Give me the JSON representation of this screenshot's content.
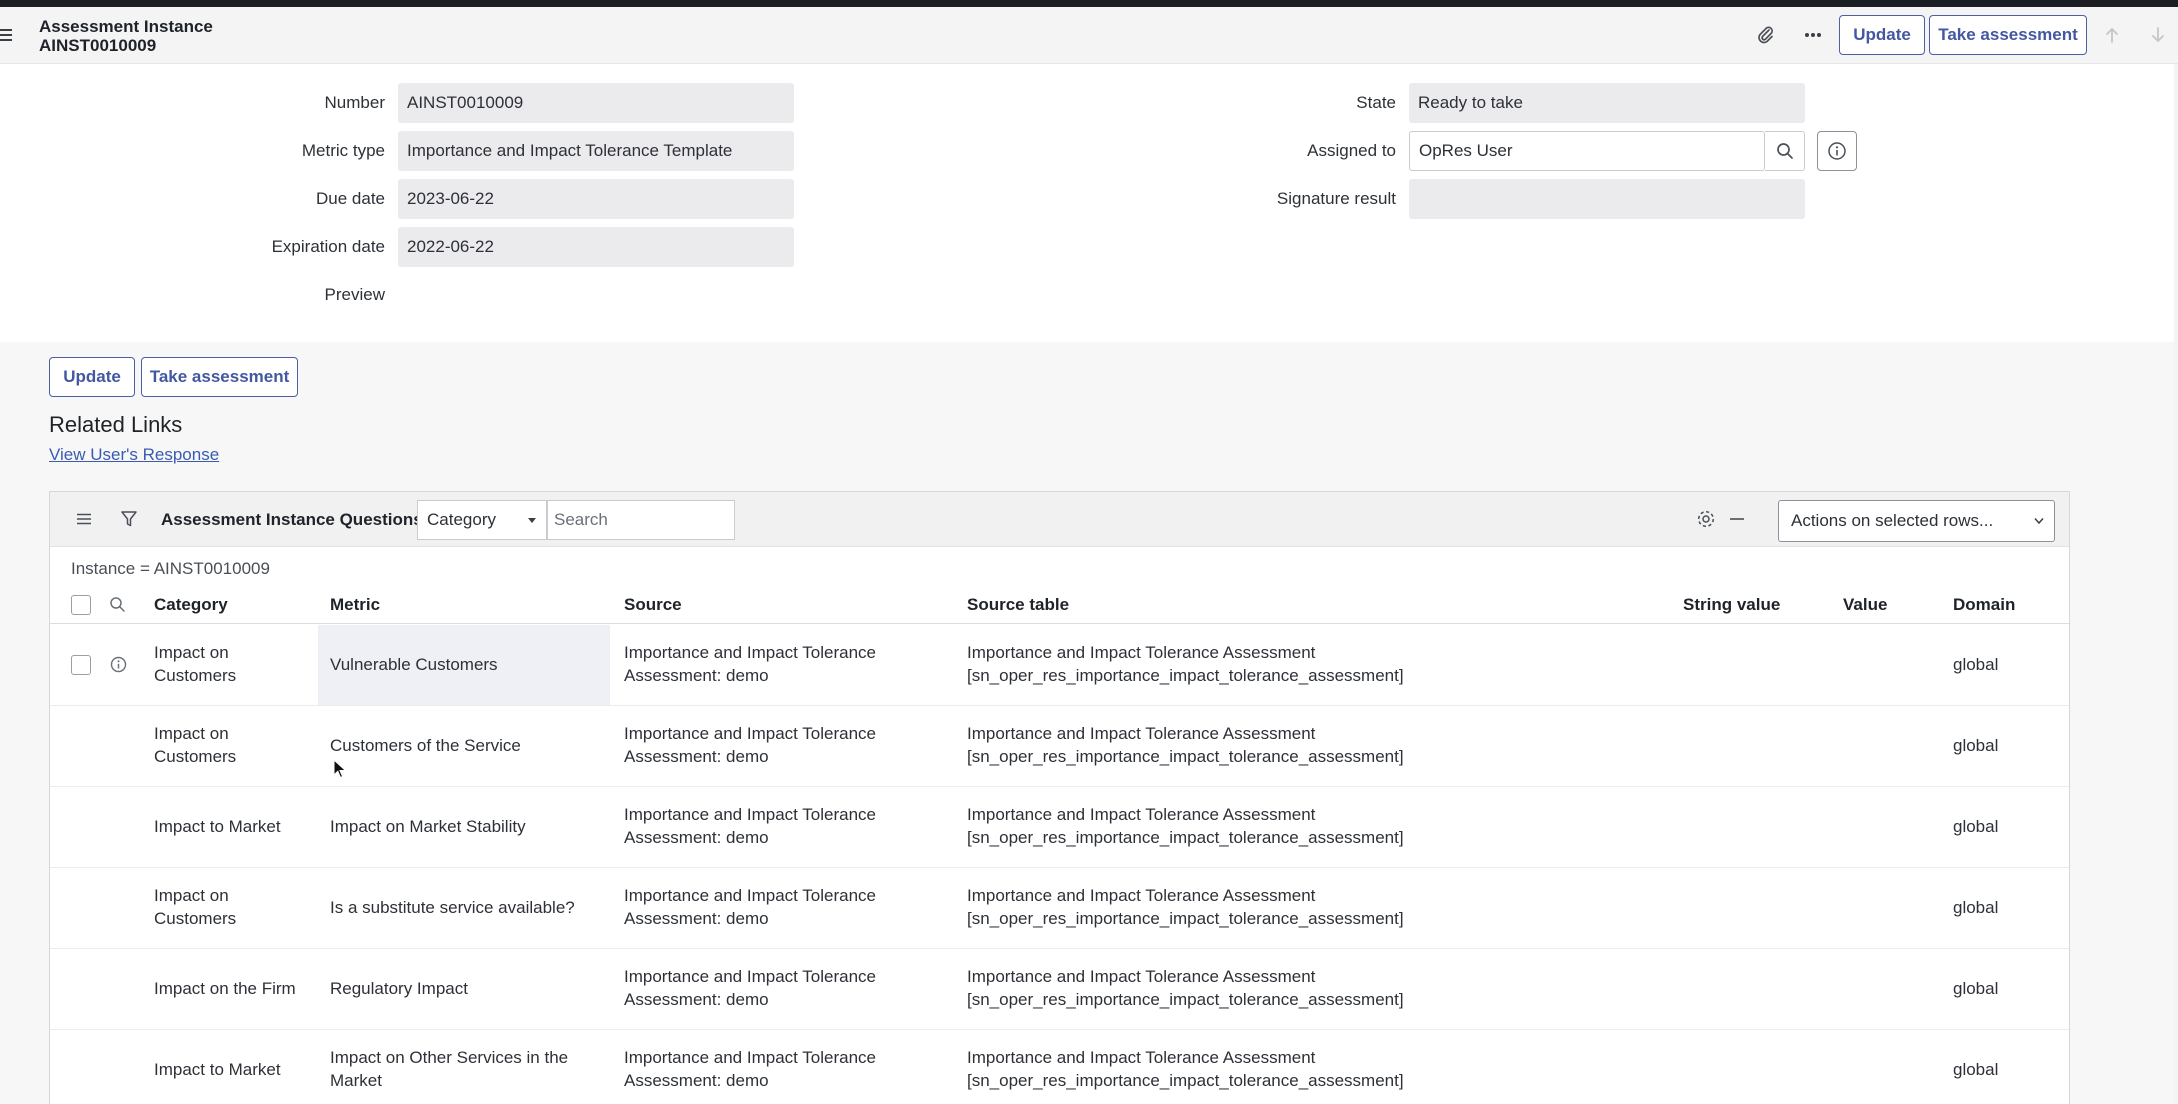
{
  "header": {
    "title_line1": "Assessment Instance",
    "title_line2": "AINST0010009",
    "update_label": "Update",
    "take_assessment_label": "Take assessment"
  },
  "form": {
    "number": {
      "label": "Number",
      "value": "AINST0010009"
    },
    "metric_type": {
      "label": "Metric type",
      "value": "Importance and Impact Tolerance Template"
    },
    "due_date": {
      "label": "Due date",
      "value": "2023-06-22"
    },
    "expiration_date": {
      "label": "Expiration date",
      "value": "2022-06-22"
    },
    "preview": {
      "label": "Preview",
      "value": ""
    },
    "state": {
      "label": "State",
      "value": "Ready to take"
    },
    "assigned_to": {
      "label": "Assigned to",
      "value": "OpRes User"
    },
    "signature_result": {
      "label": "Signature result",
      "value": ""
    }
  },
  "form_buttons": {
    "update_label": "Update",
    "take_assessment_label": "Take assessment"
  },
  "related_links": {
    "title": "Related Links",
    "view_response": "View User's Response"
  },
  "list": {
    "title": "Assessment Instance Questions",
    "search_field": "Category",
    "search_placeholder": "Search",
    "actions_label": "Actions on selected rows...",
    "breadcrumb": "Instance = AINST0010009",
    "columns": {
      "category": "Category",
      "metric": "Metric",
      "source": "Source",
      "source_table": "Source table",
      "string_value": "String value",
      "value": "Value",
      "domain": "Domain"
    },
    "rows": [
      {
        "category_line1": "Impact on",
        "category_line2": "Customers",
        "metric_line1": "Vulnerable Customers",
        "metric_line2": "",
        "source_line1": "Importance and Impact Tolerance",
        "source_line2": "Assessment: demo",
        "table_line1": "Importance and Impact Tolerance Assessment",
        "table_line2": "[sn_oper_res_importance_impact_tolerance_assessment]",
        "domain": "global"
      },
      {
        "category_line1": "Impact on",
        "category_line2": "Customers",
        "metric_line1": "Customers of the Service",
        "metric_line2": "",
        "source_line1": "Importance and Impact Tolerance",
        "source_line2": "Assessment: demo",
        "table_line1": "Importance and Impact Tolerance Assessment",
        "table_line2": "[sn_oper_res_importance_impact_tolerance_assessment]",
        "domain": "global"
      },
      {
        "category_line1": "Impact to Market",
        "category_line2": "",
        "metric_line1": "Impact on Market Stability",
        "metric_line2": "",
        "source_line1": "Importance and Impact Tolerance",
        "source_line2": "Assessment: demo",
        "table_line1": "Importance and Impact Tolerance Assessment",
        "table_line2": "[sn_oper_res_importance_impact_tolerance_assessment]",
        "domain": "global"
      },
      {
        "category_line1": "Impact on",
        "category_line2": "Customers",
        "metric_line1": "Is a substitute service available?",
        "metric_line2": "",
        "source_line1": "Importance and Impact Tolerance",
        "source_line2": "Assessment: demo",
        "table_line1": "Importance and Impact Tolerance Assessment",
        "table_line2": "[sn_oper_res_importance_impact_tolerance_assessment]",
        "domain": "global"
      },
      {
        "category_line1": "Impact on the Firm",
        "category_line2": "",
        "metric_line1": "Regulatory Impact",
        "metric_line2": "",
        "source_line1": "Importance and Impact Tolerance",
        "source_line2": "Assessment: demo",
        "table_line1": "Importance and Impact Tolerance Assessment",
        "table_line2": "[sn_oper_res_importance_impact_tolerance_assessment]",
        "domain": "global"
      },
      {
        "category_line1": "Impact to Market",
        "category_line2": "",
        "metric_line1": "Impact on Other Services in the",
        "metric_line2": "Market",
        "source_line1": "Importance and Impact Tolerance",
        "source_line2": "Assessment: demo",
        "table_line1": "Importance and Impact Tolerance Assessment",
        "table_line2": "[sn_oper_res_importance_impact_tolerance_assessment]",
        "domain": "global"
      }
    ]
  },
  "icons": {
    "menu": "hamburger-icon",
    "attachment": "paperclip-icon",
    "more": "ellipsis-icon",
    "prev": "arrow-up-icon",
    "next": "arrow-down-icon",
    "lookup": "search-icon",
    "info": "info-icon",
    "filter": "funnel-icon",
    "settings": "gear-icon",
    "collapse": "minus-icon"
  },
  "colors": {
    "accent": "#4358a0",
    "link": "#3a5cb0",
    "header_bg": "#f4f4f5",
    "field_bg": "#ebebed"
  }
}
